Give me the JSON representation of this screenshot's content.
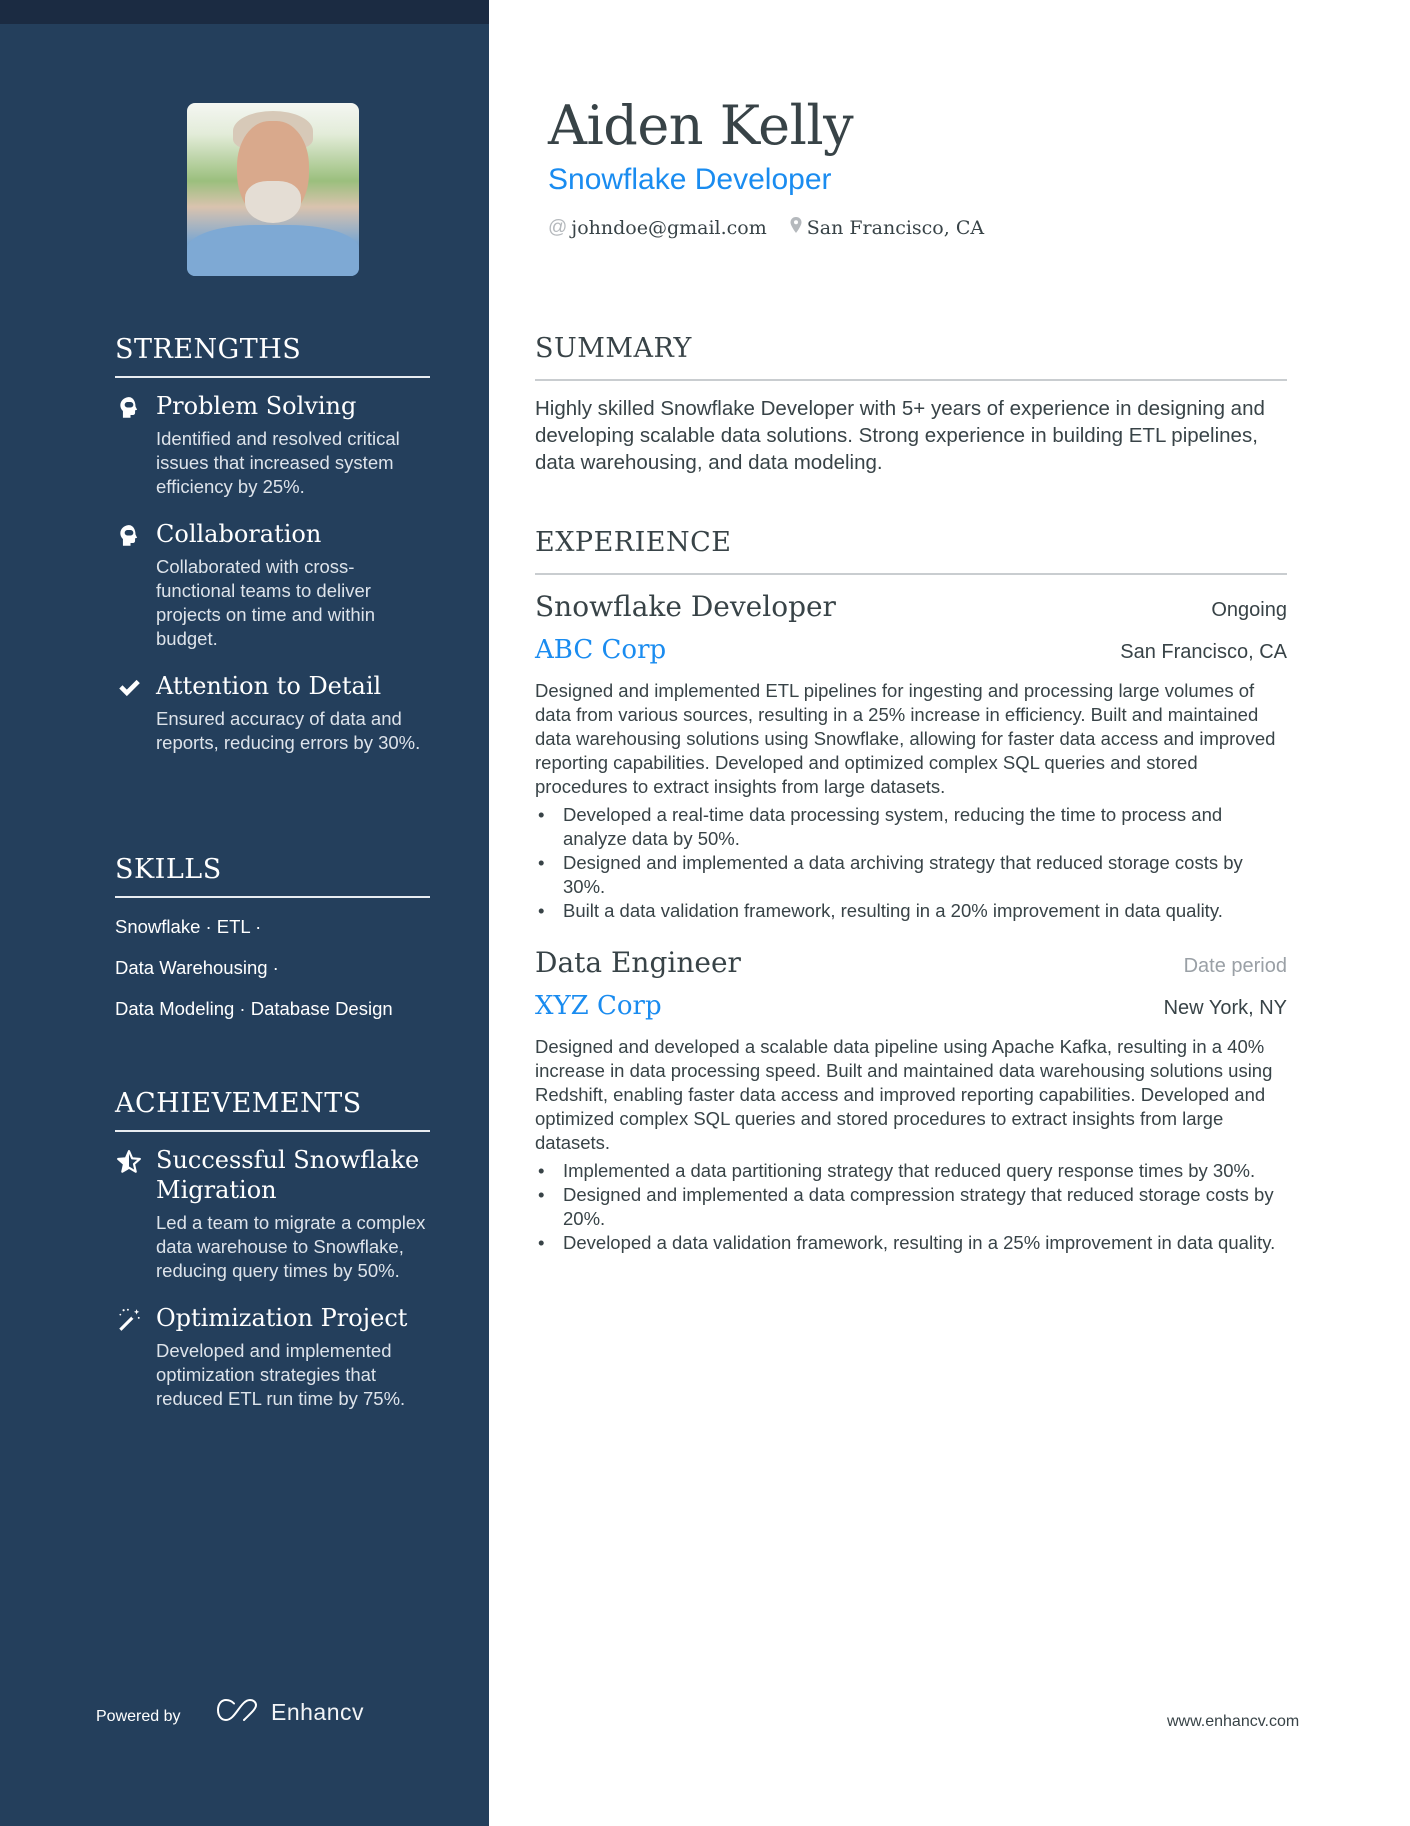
{
  "header": {
    "name": "Aiden Kelly",
    "role": "Snowflake Developer",
    "contacts": [
      {
        "icon": "at-icon",
        "glyph": "@",
        "text": "johndoe@gmail.com"
      },
      {
        "icon": "location-pin-icon",
        "glyph": "",
        "text": "San Francisco, CA"
      }
    ]
  },
  "colors": {
    "sidebar": "#243f5c",
    "top_strip": "#1b2b42",
    "accent": "#1a8cf0",
    "text": "#384347",
    "muted": "#9aa0a6"
  },
  "sidebar": {
    "photo_alt": "Profile photo",
    "strengths": {
      "title": "STRENGTHS",
      "items": [
        {
          "icon": "head-icon",
          "title": "Problem Solving",
          "desc": "Identified and resolved critical issues that increased system efficiency by 25%."
        },
        {
          "icon": "head-icon",
          "title": "Collaboration",
          "desc": "Collaborated with cross-functional teams to deliver projects on time and within budget."
        },
        {
          "icon": "checkmark-icon",
          "title": "Attention to Detail",
          "desc": "Ensured accuracy of data and reports, reducing errors by 30%."
        }
      ]
    },
    "skills": {
      "title": "SKILLS",
      "lines": [
        "Snowflake · ETL ·",
        "Data Warehousing ·",
        "Data Modeling · Database Design"
      ]
    },
    "achievements": {
      "title": "ACHIEVEMENTS",
      "items": [
        {
          "icon": "star-icon",
          "title": "Successful Snowflake Migration",
          "desc": "Led a team to migrate a complex data warehouse to Snowflake, reducing query times by 50%."
        },
        {
          "icon": "magic-wand-icon",
          "title": "Optimization Project",
          "desc": "Developed and implemented optimization strategies that reduced ETL run time by 75%."
        }
      ]
    },
    "footer": {
      "powered_by": "Powered by",
      "brand": "Enhancv"
    }
  },
  "main": {
    "summary": {
      "title": "SUMMARY",
      "text": "Highly skilled Snowflake Developer with 5+ years of experience in designing and developing scalable data solutions. Strong experience in building ETL pipelines, data warehousing, and data modeling."
    },
    "experience": {
      "title": "EXPERIENCE",
      "jobs": [
        {
          "title": "Snowflake Developer",
          "date": "Ongoing",
          "company": "ABC Corp",
          "location": "San Francisco, CA",
          "description": "Designed and implemented ETL pipelines for ingesting and processing large volumes of data from various sources, resulting in a 25% increase in efficiency. Built and maintained data warehousing solutions using Snowflake, allowing for faster data access and improved reporting capabilities. Developed and optimized complex SQL queries and stored procedures to extract insights from large datasets.",
          "bullets": [
            "Developed a real-time data processing system, reducing the time to process and analyze data by 50%.",
            "Designed and implemented a data archiving strategy that reduced storage costs by 30%.",
            "Built a data validation framework, resulting in a 20% improvement in data quality."
          ]
        },
        {
          "title": "Data Engineer",
          "date": "Date period",
          "company": "XYZ Corp",
          "location": "New York, NY",
          "description": "Designed and developed a scalable data pipeline using Apache Kafka, resulting in a 40% increase in data processing speed. Built and maintained data warehousing solutions using Redshift, enabling faster data access and improved reporting capabilities. Developed and optimized complex SQL queries and stored procedures to extract insights from large datasets.",
          "bullets": [
            "Implemented a data partitioning strategy that reduced query response times by 30%.",
            "Designed and implemented a data compression strategy that reduced storage costs by 20%.",
            "Developed a data validation framework, resulting in a 25% improvement in data quality."
          ]
        }
      ]
    }
  },
  "footer": {
    "website": "www.enhancv.com"
  }
}
